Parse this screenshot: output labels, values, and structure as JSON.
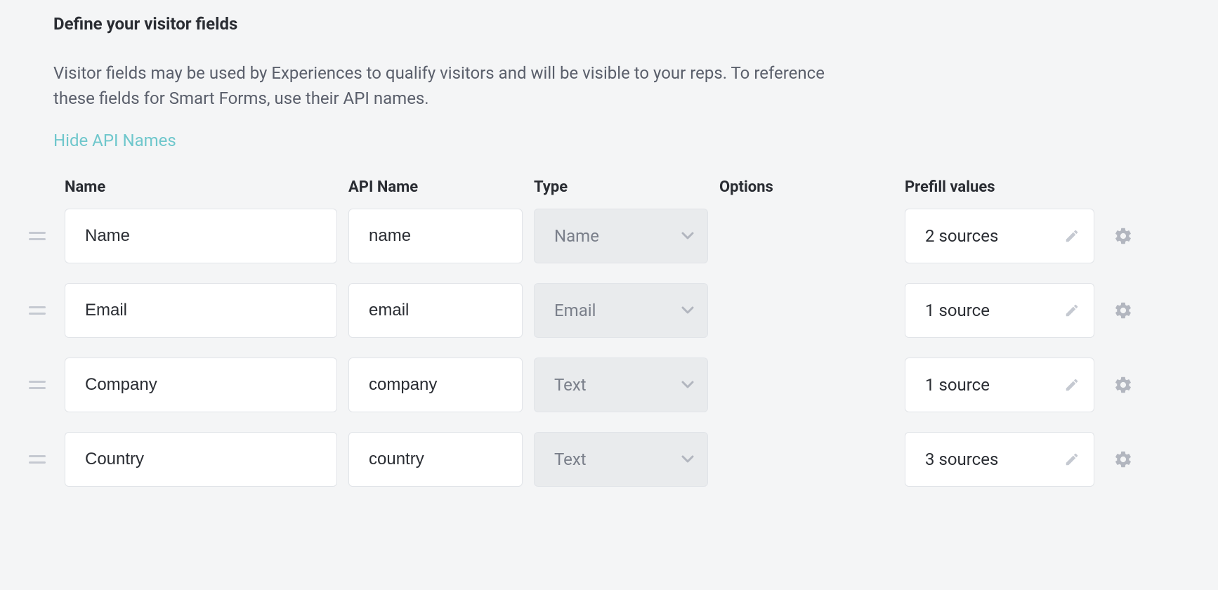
{
  "header": {
    "title": "Define your visitor fields",
    "description": "Visitor fields may be used by Experiences to qualify visitors and will be visible to your reps. To reference these fields for Smart Forms, use their API names.",
    "toggleLink": "Hide API Names"
  },
  "columns": {
    "name": "Name",
    "apiName": "API Name",
    "type": "Type",
    "options": "Options",
    "prefill": "Prefill values"
  },
  "rows": [
    {
      "name": "Name",
      "apiName": "name",
      "type": "Name",
      "prefill": "2 sources"
    },
    {
      "name": "Email",
      "apiName": "email",
      "type": "Email",
      "prefill": "1 source"
    },
    {
      "name": "Company",
      "apiName": "company",
      "type": "Text",
      "prefill": "1 source"
    },
    {
      "name": "Country",
      "apiName": "country",
      "type": "Text",
      "prefill": "3 sources"
    }
  ]
}
